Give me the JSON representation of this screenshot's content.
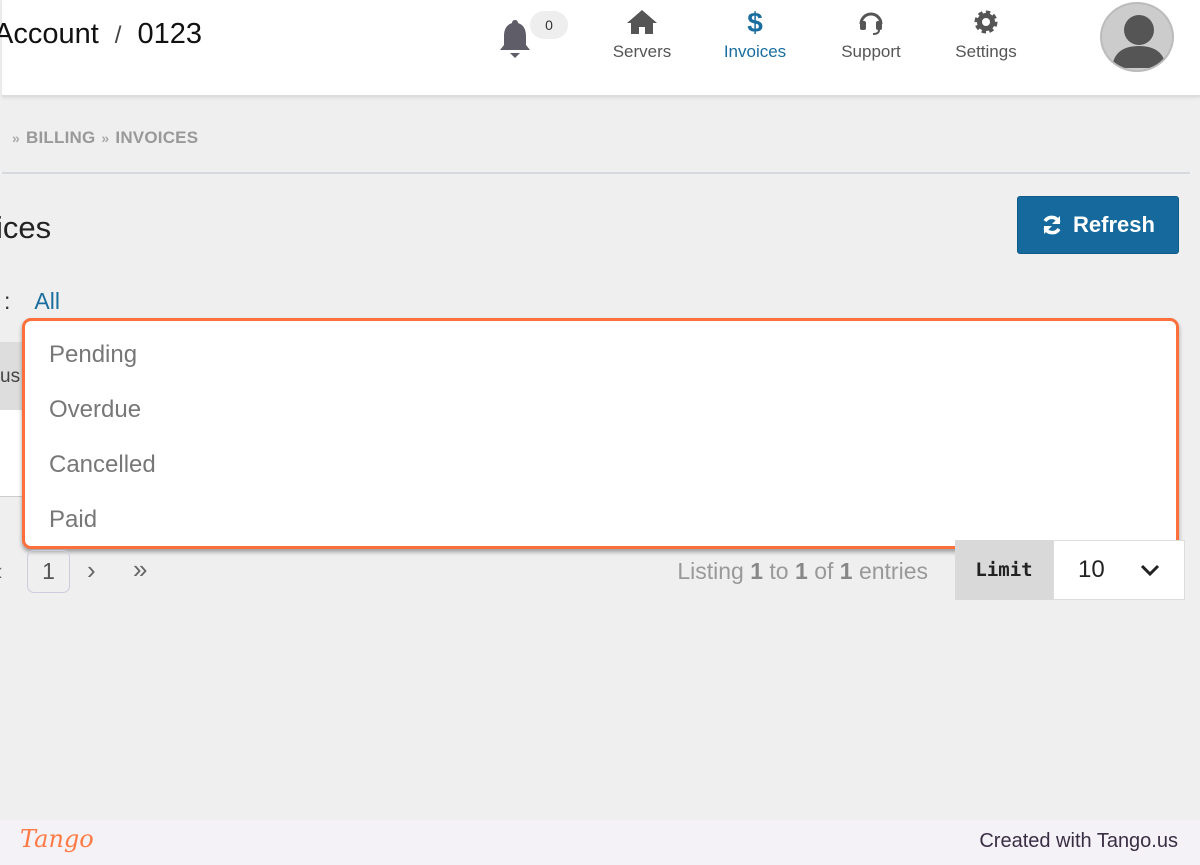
{
  "header": {
    "account_label": "Account",
    "separator": "/",
    "account_number": "0123",
    "notifications_count": "0",
    "nav": [
      {
        "label": "Servers",
        "icon": "home-icon"
      },
      {
        "label": "Invoices",
        "icon": "dollar-icon",
        "active": true
      },
      {
        "label": "Support",
        "icon": "headset-icon"
      },
      {
        "label": "Settings",
        "icon": "gear-icon"
      }
    ]
  },
  "breadcrumb": {
    "sep": "»",
    "items": [
      "BILLING",
      "INVOICES"
    ]
  },
  "page": {
    "title": "ices",
    "refresh_label": "Refresh",
    "filter_label": ":",
    "filter_value": "All",
    "table_header_fragment": "us"
  },
  "dropdown": {
    "options": [
      "Pending",
      "Overdue",
      "Cancelled",
      "Paid"
    ]
  },
  "pagination": {
    "prev": "‹",
    "current": "1",
    "next": "›",
    "last": "»",
    "listing": {
      "prefix": "Listing",
      "from": "1",
      "to_word": "to",
      "to": "1",
      "of_word": "of",
      "total": "1",
      "suffix": "entries"
    },
    "limit_label": "Limit",
    "limit_value": "10"
  },
  "footer": {
    "logo": "Tango",
    "credit": "Created with Tango.us"
  },
  "colors": {
    "accent": "#1a6e9f",
    "highlight": "#ff6f3c"
  }
}
